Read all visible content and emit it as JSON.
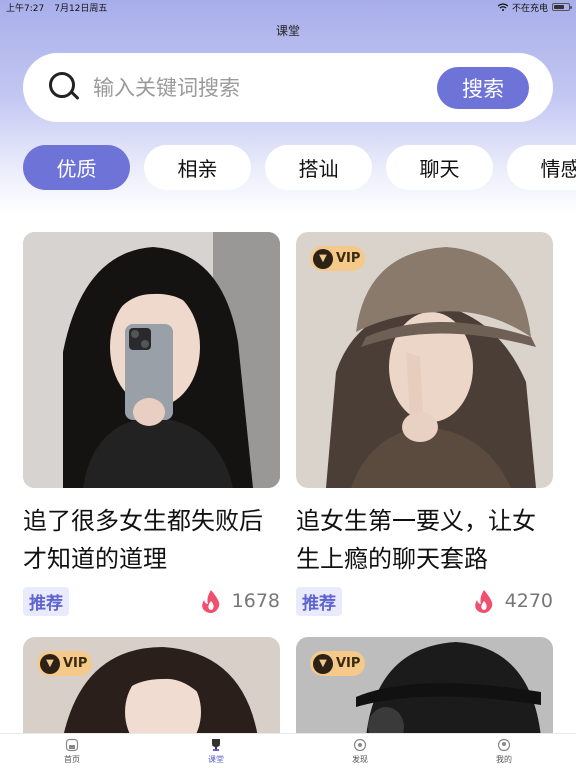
{
  "status_bar": {
    "time": "上午7:27",
    "date": "7月12日周五",
    "charging": "不在充电"
  },
  "page_title": "课堂",
  "search": {
    "placeholder": "输入关键词搜索",
    "button_label": "搜索"
  },
  "tabs": [
    {
      "label": "优质",
      "active": true
    },
    {
      "label": "相亲",
      "active": false
    },
    {
      "label": "搭讪",
      "active": false
    },
    {
      "label": "聊天",
      "active": false
    },
    {
      "label": "情感",
      "active": false
    }
  ],
  "cards": [
    {
      "title": "追了很多女生都失败后才知道的道理",
      "tag": "推荐",
      "count": "1678",
      "vip": false
    },
    {
      "title": "追女生第一要义，让女生上瘾的聊天套路",
      "tag": "推荐",
      "count": "4270",
      "vip": true,
      "vip_label": "VIP"
    },
    {
      "vip": true,
      "vip_label": "VIP"
    },
    {
      "vip": true,
      "vip_label": "VIP"
    }
  ],
  "tabbar": [
    {
      "label": "首页",
      "icon": "home-icon"
    },
    {
      "label": "课堂",
      "icon": "trophy-icon",
      "active": true
    },
    {
      "label": "发现",
      "icon": "discover-icon"
    },
    {
      "label": "我的",
      "icon": "profile-icon"
    }
  ],
  "colors": {
    "accent": "#6e73d8",
    "tag_bg": "#e9eafb",
    "vip_gold": "#f4c98a",
    "fire": "#f0506e"
  }
}
